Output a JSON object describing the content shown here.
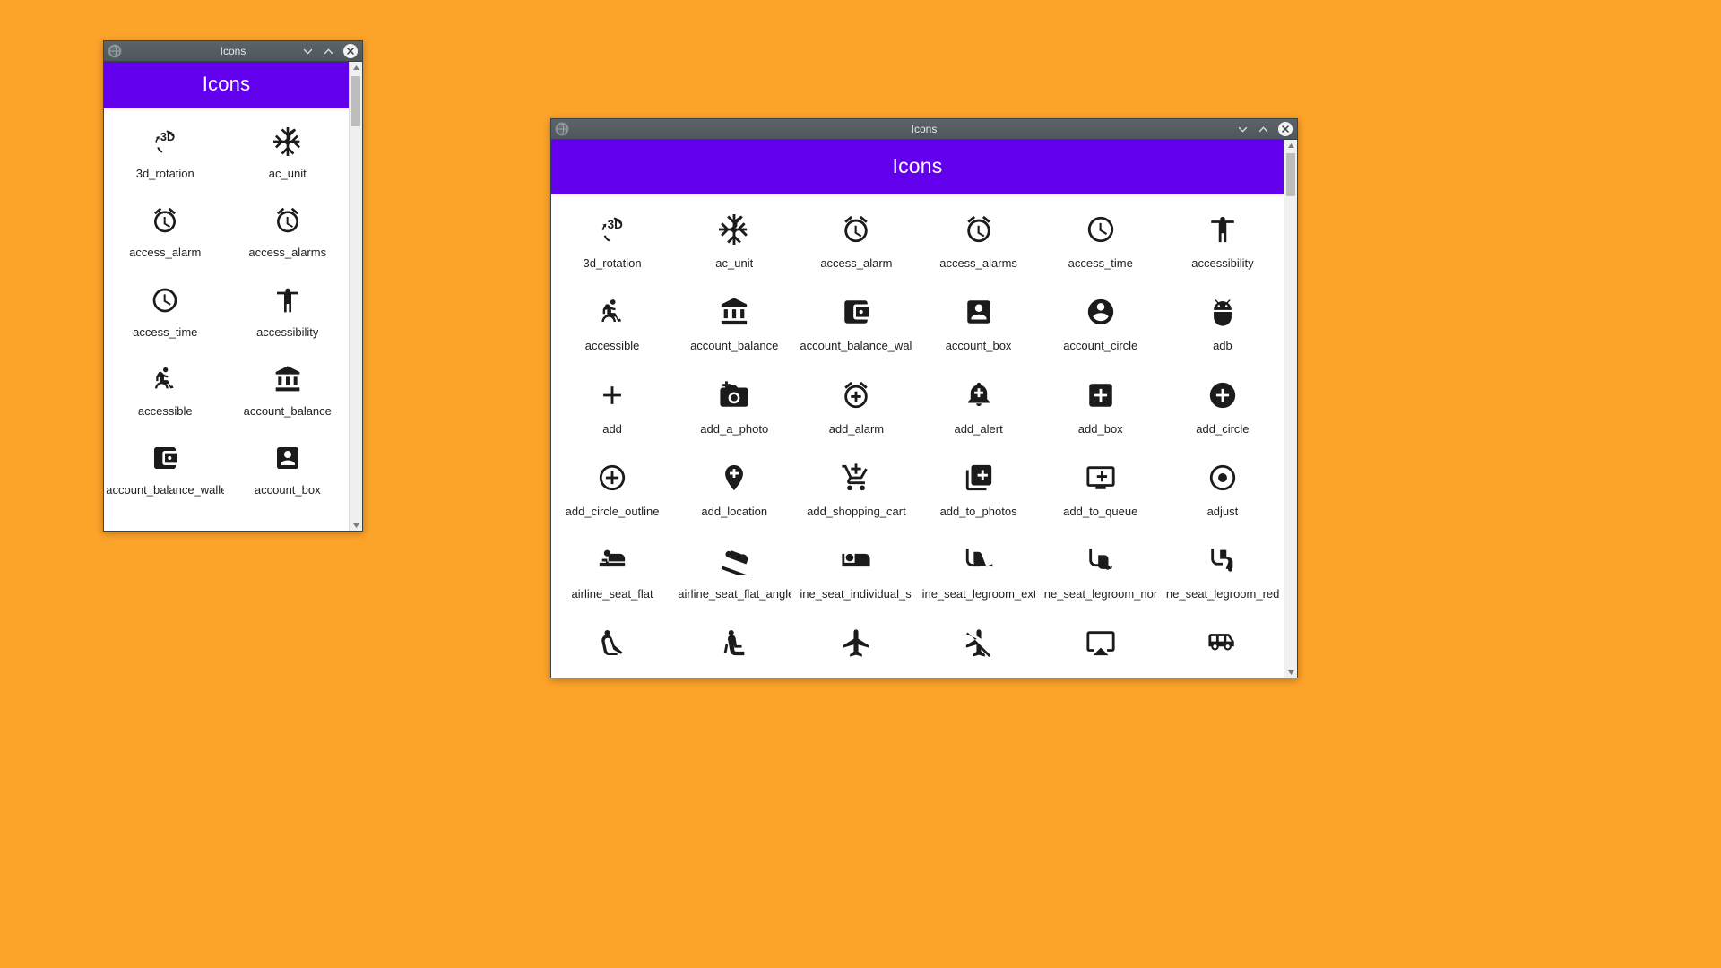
{
  "desktop": {
    "background_color": "#fca32a"
  },
  "theme": {
    "titlebar_color": "#4e575c",
    "app_header_color": "#6200ee",
    "icon_color": "#1b1b1b",
    "label_color": "#202124",
    "scrollbar_track_color": "#f0f0f0",
    "scrollbar_thumb_color": "#bdbdbd"
  },
  "windows": [
    {
      "id": "small",
      "titlebar": {
        "title": "Icons",
        "app_icon": "globe-icon",
        "minimize_label": "chevron-down-icon",
        "maximize_label": "chevron-up-icon",
        "close_label": "close-icon"
      },
      "header": {
        "title": "Icons"
      },
      "columns": 2,
      "icons": [
        {
          "name": "3d_rotation",
          "glyph": "3d-rotation-icon"
        },
        {
          "name": "ac_unit",
          "glyph": "ac-unit-icon"
        },
        {
          "name": "access_alarm",
          "glyph": "access-alarm-icon"
        },
        {
          "name": "access_alarms",
          "glyph": "access-alarms-icon"
        },
        {
          "name": "access_time",
          "glyph": "access-time-icon"
        },
        {
          "name": "accessibility",
          "glyph": "accessibility-icon"
        },
        {
          "name": "accessible",
          "glyph": "accessible-icon"
        },
        {
          "name": "account_balance",
          "glyph": "account-balance-icon"
        },
        {
          "name": "account_balance_wallet",
          "glyph": "account-balance-wallet-icon"
        },
        {
          "name": "account_box",
          "glyph": "account-box-icon"
        }
      ],
      "scrollbar": {
        "up_arrow": "scroll-up-arrow",
        "down_arrow": "scroll-down-arrow"
      }
    },
    {
      "id": "large",
      "titlebar": {
        "title": "Icons",
        "app_icon": "globe-icon",
        "minimize_label": "chevron-down-icon",
        "maximize_label": "chevron-up-icon",
        "close_label": "close-icon"
      },
      "header": {
        "title": "Icons"
      },
      "columns": 6,
      "icons": [
        {
          "name": "3d_rotation",
          "glyph": "3d-rotation-icon"
        },
        {
          "name": "ac_unit",
          "glyph": "ac-unit-icon"
        },
        {
          "name": "access_alarm",
          "glyph": "access-alarm-icon"
        },
        {
          "name": "access_alarms",
          "glyph": "access-alarms-icon"
        },
        {
          "name": "access_time",
          "glyph": "access-time-icon"
        },
        {
          "name": "accessibility",
          "glyph": "accessibility-icon"
        },
        {
          "name": "accessible",
          "glyph": "accessible-icon"
        },
        {
          "name": "account_balance",
          "glyph": "account-balance-icon"
        },
        {
          "name": "account_balance_walle",
          "glyph": "account-balance-wallet-icon"
        },
        {
          "name": "account_box",
          "glyph": "account-box-icon"
        },
        {
          "name": "account_circle",
          "glyph": "account-circle-icon"
        },
        {
          "name": "adb",
          "glyph": "adb-icon"
        },
        {
          "name": "add",
          "glyph": "add-icon"
        },
        {
          "name": "add_a_photo",
          "glyph": "add-a-photo-icon"
        },
        {
          "name": "add_alarm",
          "glyph": "add-alarm-icon"
        },
        {
          "name": "add_alert",
          "glyph": "add-alert-icon"
        },
        {
          "name": "add_box",
          "glyph": "add-box-icon"
        },
        {
          "name": "add_circle",
          "glyph": "add-circle-icon"
        },
        {
          "name": "add_circle_outline",
          "glyph": "add-circle-outline-icon"
        },
        {
          "name": "add_location",
          "glyph": "add-location-icon"
        },
        {
          "name": "add_shopping_cart",
          "glyph": "add-shopping-cart-icon"
        },
        {
          "name": "add_to_photos",
          "glyph": "add-to-photos-icon"
        },
        {
          "name": "add_to_queue",
          "glyph": "add-to-queue-icon"
        },
        {
          "name": "adjust",
          "glyph": "adjust-icon"
        },
        {
          "name": "airline_seat_flat",
          "glyph": "airline-seat-flat-icon"
        },
        {
          "name": "airline_seat_flat_angle",
          "glyph": "airline-seat-flat-angled-icon"
        },
        {
          "name": "ine_seat_individual_su",
          "glyph": "airline-seat-individual-suite-icon"
        },
        {
          "name": "ine_seat_legroom_ext",
          "glyph": "airline-seat-legroom-extra-icon"
        },
        {
          "name": "ne_seat_legroom_norm",
          "glyph": "airline-seat-legroom-normal-icon"
        },
        {
          "name": "ne_seat_legroom_redu",
          "glyph": "airline-seat-legroom-reduced-icon"
        },
        {
          "name": "",
          "glyph": "airline-seat-recline-extra-icon"
        },
        {
          "name": "",
          "glyph": "airline-seat-recline-normal-icon"
        },
        {
          "name": "",
          "glyph": "airplanemode-active-icon"
        },
        {
          "name": "",
          "glyph": "airplanemode-inactive-icon"
        },
        {
          "name": "",
          "glyph": "airplay-icon"
        },
        {
          "name": "",
          "glyph": "airport-shuttle-icon"
        }
      ],
      "scrollbar": {
        "up_arrow": "scroll-up-arrow",
        "down_arrow": "scroll-down-arrow"
      }
    }
  ]
}
